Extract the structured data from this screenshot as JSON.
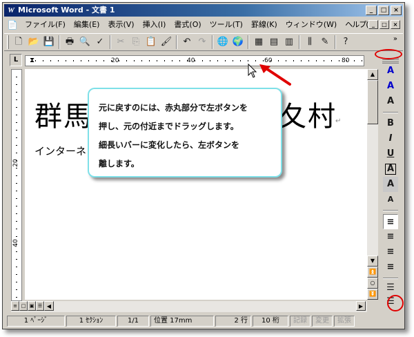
{
  "window": {
    "app_icon": "W",
    "title": "Microsoft Word - 文書 1",
    "buttons": [
      "_",
      "□",
      "×"
    ]
  },
  "menubar": {
    "doc_icon": "document-icon",
    "items": [
      "ファイル(F)",
      "編集(E)",
      "表示(V)",
      "挿入(I)",
      "書式(O)",
      "ツール(T)",
      "罫線(K)",
      "ウィンドウ(W)",
      "ヘルプ(H)"
    ],
    "mdi_buttons": [
      "_",
      "□",
      "×"
    ]
  },
  "toolbar": {
    "tools": [
      "new-icon",
      "open-icon",
      "save-icon",
      "print-icon",
      "preview-icon",
      "spellcheck-icon",
      "cut-icon",
      "copy-icon",
      "paste-icon",
      "format-painter-icon",
      "undo-icon",
      "redo-icon",
      "hyperlink-icon",
      "web-toolbar-icon",
      "tables-borders-icon",
      "insert-table-icon",
      "insert-excel-icon",
      "columns-icon",
      "drawing-icon",
      "help-icon"
    ],
    "overflow": "»"
  },
  "ruler": {
    "corner": "L",
    "labels": [
      "20",
      "40",
      "60",
      "80"
    ],
    "vertical_labels": [
      "20",
      "40"
    ]
  },
  "document": {
    "title_left": "群馬",
    "title_right": "夂村",
    "line2": "インターネット講"
  },
  "callout": {
    "lines": [
      "元に戻すのには、赤丸部分で左ボタンを",
      "押し、元の付近までドラッグします。",
      "細長いバーに変化したら、左ボタンを",
      "離します。"
    ]
  },
  "format_toolbar": {
    "tools": [
      "A",
      "A",
      "A",
      "B",
      "I",
      "U",
      "A",
      "A",
      "A",
      "≡",
      "≡",
      "≡",
      "≡",
      "☰",
      "☰"
    ]
  },
  "statusbar": {
    "page": "1 ﾍﾟｰｼﾞ",
    "section": "1 ｾｸｼｮﾝ",
    "pages": "1/1",
    "position": "位置 17mm",
    "line": "2 行",
    "column": "10 桁",
    "rec": "記録",
    "trk": "変更",
    "ext": "拡張"
  },
  "colors": {
    "highlight": "#e00000",
    "callout_border": "#7ee0e8",
    "titlebar": "#0a246a"
  }
}
